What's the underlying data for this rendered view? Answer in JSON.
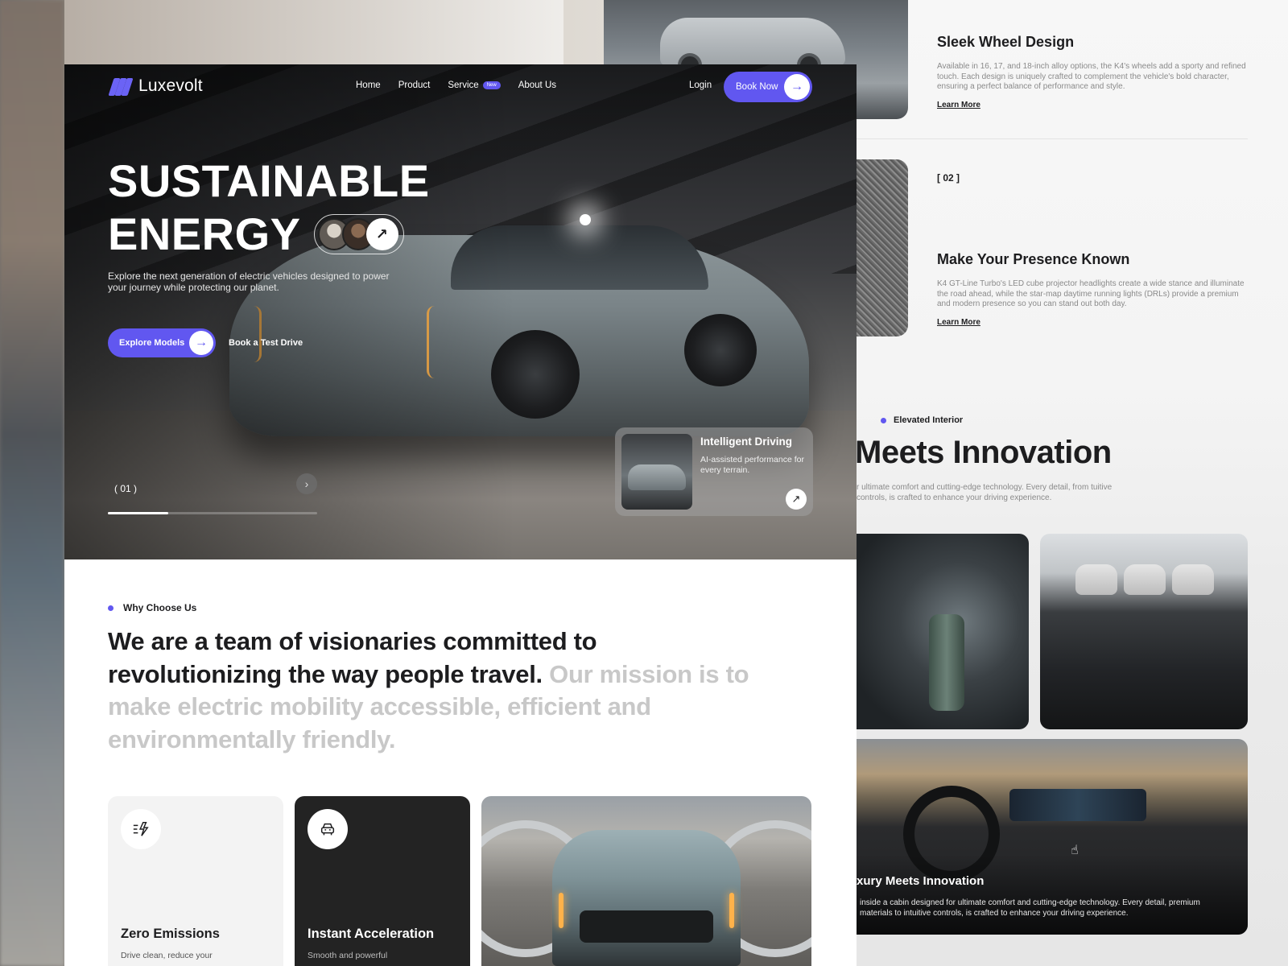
{
  "brand": {
    "name": "Luxevolt",
    "accent": "#6157f0"
  },
  "nav": {
    "links": [
      {
        "label": "Home"
      },
      {
        "label": "Product"
      },
      {
        "label": "Service",
        "badge": "New"
      },
      {
        "label": "About Us"
      }
    ],
    "login": "Login",
    "cta": "Book Now"
  },
  "hero": {
    "title_line1": "SUSTAINABLE",
    "title_line2": "ENERGY",
    "description": "Explore the next generation of electric vehicles designed to power your journey while protecting our planet.",
    "primary_cta": "Explore Models",
    "secondary_cta": "Book a Test Drive",
    "slide_counter": "( 01 )",
    "slide_progress": 0.29,
    "feature_card": {
      "title": "Intelligent Driving",
      "description": "AI-assisted performance for every terrain."
    }
  },
  "why": {
    "eyebrow": "Why Choose Us",
    "statement_dark": "We are a team of visionaries committed to revolutionizing the way people travel.",
    "statement_light": " Our mission is to make electric mobility accessible, efficient and environmentally friendly."
  },
  "cards": [
    {
      "title": "Zero Emissions",
      "description": "Drive clean, reduce your",
      "icon": "lightning-icon"
    },
    {
      "title": "Instant Acceleration",
      "description": "Smooth and powerful",
      "icon": "car-seat-icon"
    }
  ],
  "design_features": [
    {
      "title": "Sleek Wheel Design",
      "description": "Available in 16, 17, and 18-inch alloy options, the K4's wheels add a sporty and refined touch. Each design is uniquely crafted to complement the vehicle's bold character, ensuring a perfect balance of performance and style.",
      "link": "Learn More"
    },
    {
      "number": "[ 02 ]",
      "title": "Make Your Presence Known",
      "description": "K4 GT-Line Turbo's LED cube projector headlights create a wide stance and illuminate the road ahead, while the star-map daytime running lights (DRLs) provide a premium and modern presence so you can stand out both day.",
      "link": "Learn More"
    }
  ],
  "interior": {
    "eyebrow": "Elevated Interior",
    "heading": "Meets Innovation",
    "description": "r ultimate comfort and cutting-edge technology. Every detail, from tuitive controls, is crafted to enhance your driving experience.",
    "overlay_title": "xury Meets Innovation",
    "overlay_description": "inside a cabin designed for ultimate comfort and cutting-edge technology. Every detail, premium materials to intuitive controls, is crafted to enhance your driving experience."
  }
}
